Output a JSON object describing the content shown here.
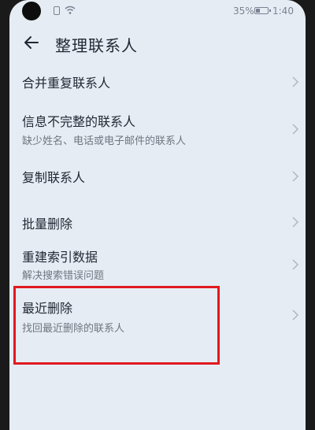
{
  "status_bar": {
    "battery_percent": "35%",
    "battery_level": 0.35,
    "time": "1:40"
  },
  "header": {
    "title": "整理联系人"
  },
  "menu": {
    "items": [
      {
        "title": "合并重复联系人",
        "subtitle": ""
      },
      {
        "title": "信息不完整的联系人",
        "subtitle": "缺少姓名、电话或电子邮件的联系人"
      },
      {
        "title": "复制联系人",
        "subtitle": ""
      },
      {
        "title": "批量删除",
        "subtitle": ""
      },
      {
        "title": "重建索引数据",
        "subtitle": "解决搜索错误问题"
      },
      {
        "title": "最近删除",
        "subtitle": "找回最近删除的联系人"
      }
    ]
  },
  "colors": {
    "background": "#e6ecf3",
    "title_text": "#1f2733",
    "subtitle_text": "#6f7680",
    "highlight": "#e0191f"
  }
}
